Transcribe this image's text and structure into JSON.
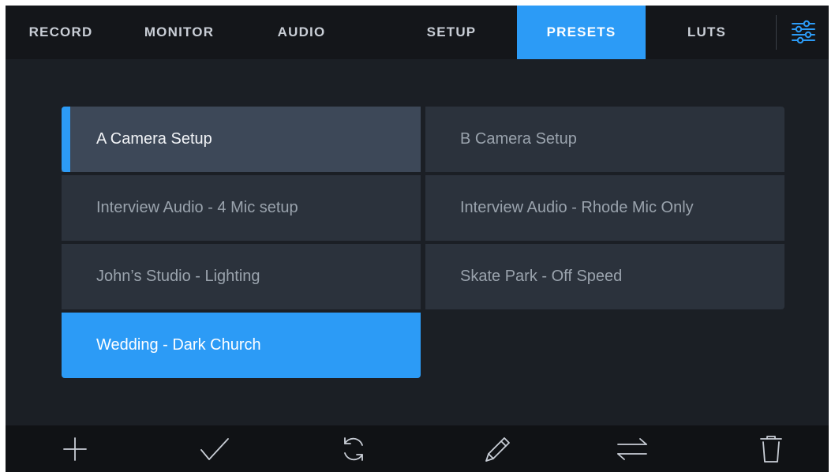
{
  "tabs": [
    {
      "label": "RECORD",
      "active": false
    },
    {
      "label": "MONITOR",
      "active": false
    },
    {
      "label": "AUDIO",
      "active": false
    },
    {
      "label": "SETUP",
      "active": false
    },
    {
      "label": "PRESETS",
      "active": true
    },
    {
      "label": "LUTS",
      "active": false
    }
  ],
  "settings_icon": "sliders-icon",
  "presets": [
    {
      "label": "A Camera Setup",
      "state": "loaded"
    },
    {
      "label": "B Camera Setup",
      "state": "normal"
    },
    {
      "label": "Interview Audio - 4 Mic setup",
      "state": "normal"
    },
    {
      "label": "Interview Audio - Rhode Mic Only",
      "state": "normal"
    },
    {
      "label": "John’s Studio - Lighting",
      "state": "normal"
    },
    {
      "label": "Skate Park - Off Speed",
      "state": "normal"
    },
    {
      "label": "Wedding  - Dark Church",
      "state": "selected"
    }
  ],
  "toolbar": [
    {
      "icon": "plus-icon"
    },
    {
      "icon": "checkmark-icon"
    },
    {
      "icon": "refresh-icon"
    },
    {
      "icon": "pencil-icon"
    },
    {
      "icon": "swap-arrows-icon"
    },
    {
      "icon": "trash-icon"
    }
  ],
  "colors": {
    "accent": "#2c9bf6",
    "background": "#1b1f25",
    "tile": "#2b323c",
    "tile_loaded": "#3d4858",
    "tab_bar": "#14161a",
    "toolbar": "#101215"
  }
}
